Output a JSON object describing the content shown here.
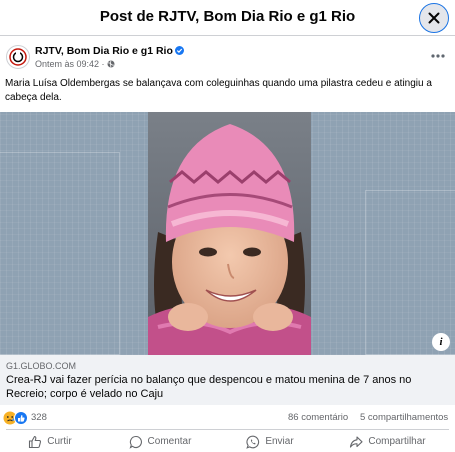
{
  "dialog": {
    "title": "Post de RJTV, Bom Dia Rio e g1 Rio"
  },
  "post": {
    "page_name": "RJTV, Bom Dia Rio e g1 Rio",
    "timestamp": "Ontem às 09:42 · ",
    "caption": "Maria Luísa Oldembergas se balançava com coleguinhas quando uma pilastra cedeu e atingiu a cabeça dela."
  },
  "link_preview": {
    "domain": "G1.GLOBO.COM",
    "title": "Crea-RJ vai fazer perícia no balanço que despencou e matou menina de 7 anos no Recreio; corpo é velado no Caju"
  },
  "stats": {
    "reactions_count": "328",
    "comments": "86 comentário",
    "shares": "5 compartilhamentos"
  },
  "actions": {
    "like": "Curtir",
    "comment": "Comentar",
    "send": "Enviar",
    "share": "Compartilhar"
  },
  "icons": {
    "close": "close-icon",
    "more": "more-options-icon",
    "globe": "globe-icon",
    "verified": "verified-badge-icon",
    "info": "info-icon",
    "sad_reaction": "sad-reaction-icon",
    "like_reaction": "like-reaction-icon"
  },
  "colors": {
    "accent": "#1877f2",
    "secondary_text": "#65676b",
    "link_box_bg": "#f0f2f5"
  }
}
